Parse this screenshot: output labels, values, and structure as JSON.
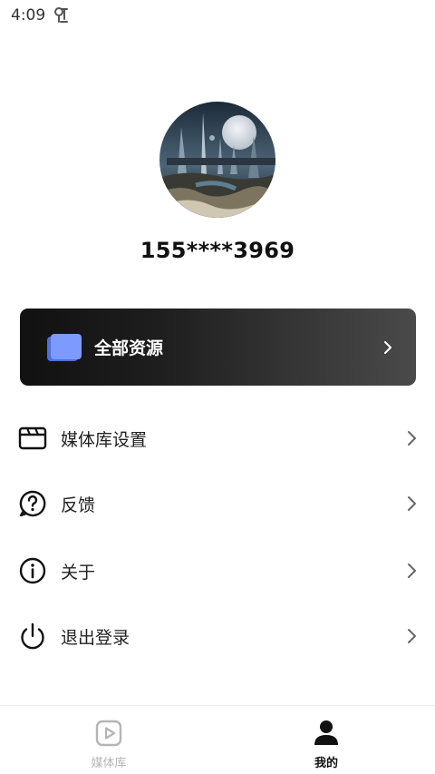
{
  "status_bar": {
    "time": "4:09",
    "app_icon": "app-notification-icon"
  },
  "profile": {
    "phone": "155****3969",
    "avatar": "avatar-image-futuristic-city-moon"
  },
  "resource_card": {
    "label": "全部资源",
    "icon": "folder-icon",
    "chevron": "chevron-right-icon"
  },
  "menu": {
    "items": [
      {
        "label": "媒体库设置",
        "icon": "media-library-icon"
      },
      {
        "label": "反馈",
        "icon": "question-bubble-icon"
      },
      {
        "label": "关于",
        "icon": "info-icon"
      },
      {
        "label": "退出登录",
        "icon": "power-icon"
      }
    ]
  },
  "tabs": [
    {
      "label": "媒体库",
      "icon": "play-square-icon",
      "active": false
    },
    {
      "label": "我的",
      "icon": "person-icon",
      "active": true
    }
  ],
  "colors": {
    "card_start": "#111111",
    "card_end": "#4a4a4a",
    "folder_blue": "#6d8df5",
    "inactive_tab": "#b5b5b5"
  }
}
